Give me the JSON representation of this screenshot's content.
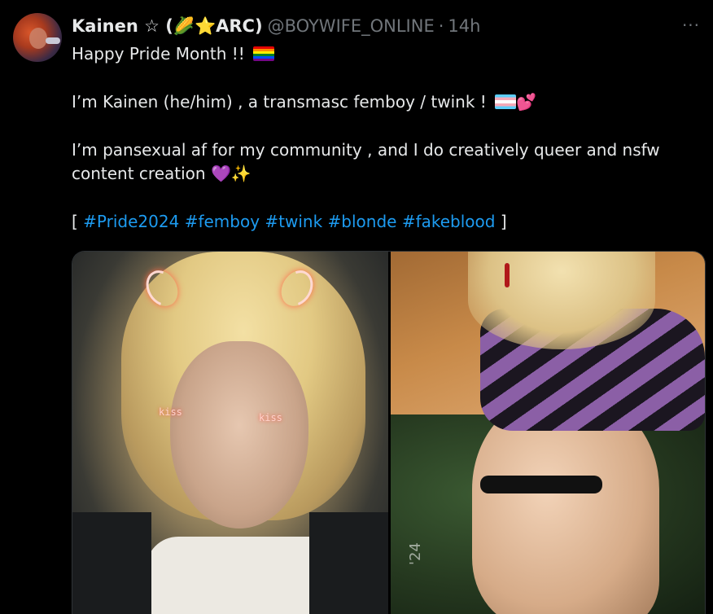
{
  "tweet": {
    "author": {
      "display_name": "Kainen ☆ (🌽⭐ARC)",
      "handle": "@BOYWIFE_ONLINE",
      "separator": "·",
      "time": "14h"
    },
    "more_label": "···",
    "lines": {
      "l1_text": "Happy Pride Month !! ",
      "l2_text": "I’m Kainen (he/him) , a transmasc femboy / twink ! ",
      "l2_emoji": "💕",
      "l3_text": "I’m pansexual af for my community , and I do creatively queer and nsfw",
      "l4_text": "content creation ",
      "l4_emoji": "💜✨",
      "bracket_open": "[ ",
      "bracket_close": " ]"
    },
    "hashtags": [
      "#Pride2024",
      "#femboy",
      "#twink",
      "#blonde",
      "#fakeblood"
    ],
    "media": {
      "left": {
        "sticker_left": "kiss",
        "sticker_right": "kiss"
      },
      "right": {
        "watermark": "'24"
      }
    }
  },
  "colors": {
    "background": "#000000",
    "text": "#e7e9ea",
    "secondary": "#71767b",
    "link": "#1d9bf0"
  },
  "icons": {
    "more": "more-horizontal-icon",
    "rainbow_flag": "rainbow-flag-icon",
    "trans_flag": "transgender-flag-icon"
  }
}
